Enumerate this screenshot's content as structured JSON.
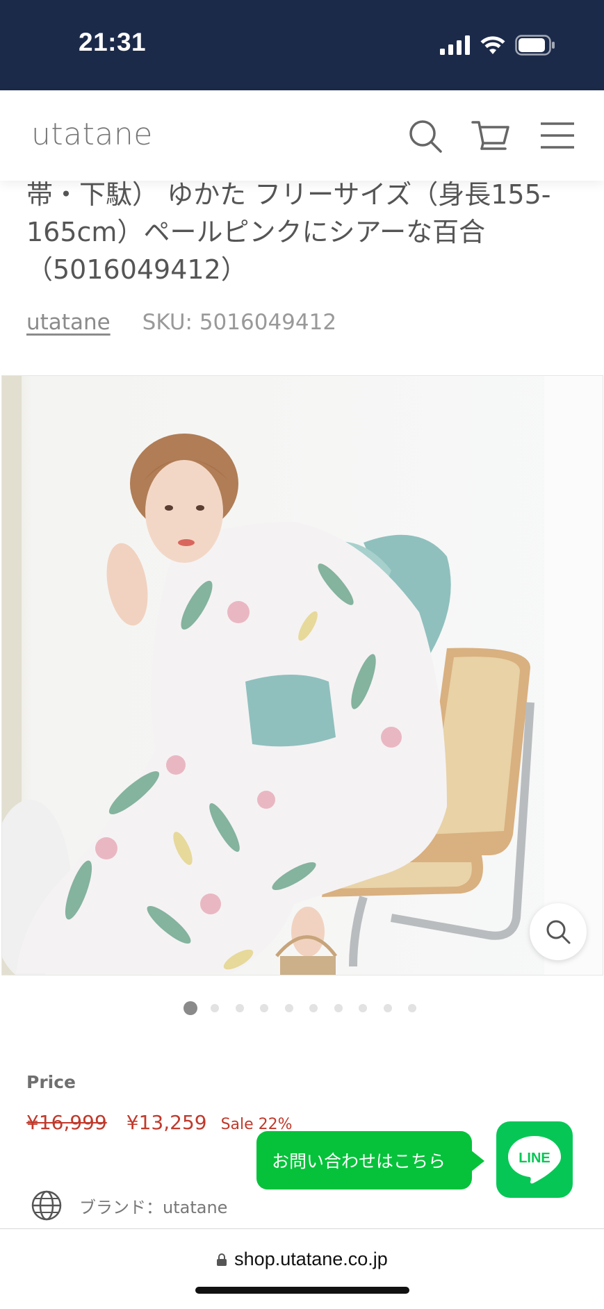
{
  "status_bar": {
    "time": "21:31"
  },
  "header": {
    "logo": "utatane"
  },
  "product": {
    "title": "帯・下駄） ゆかた フリーサイズ（身長155-165cm）ペールピンクにシアーな百合（5016049412）",
    "vendor": "utatane",
    "sku": "SKU: 5016049412",
    "image_alt": "Model in white yukata with pink lilies and mint obi sitting on a rattan chair"
  },
  "gallery": {
    "total_slides": 10,
    "active_slide": 1
  },
  "price": {
    "label": "Price",
    "original": "¥16,999",
    "current": "¥13,259",
    "sale": "Sale 22%"
  },
  "brand": {
    "text": "ブランド：utatane"
  },
  "line_widget": {
    "bubble_text": "お問い合わせはこちら",
    "logo_text": "LINE"
  },
  "browser": {
    "url": "shop.utatane.co.jp"
  },
  "colors": {
    "status_bar": "#1c2a4a",
    "sale_red": "#c0392b",
    "line_green": "#06c755"
  }
}
